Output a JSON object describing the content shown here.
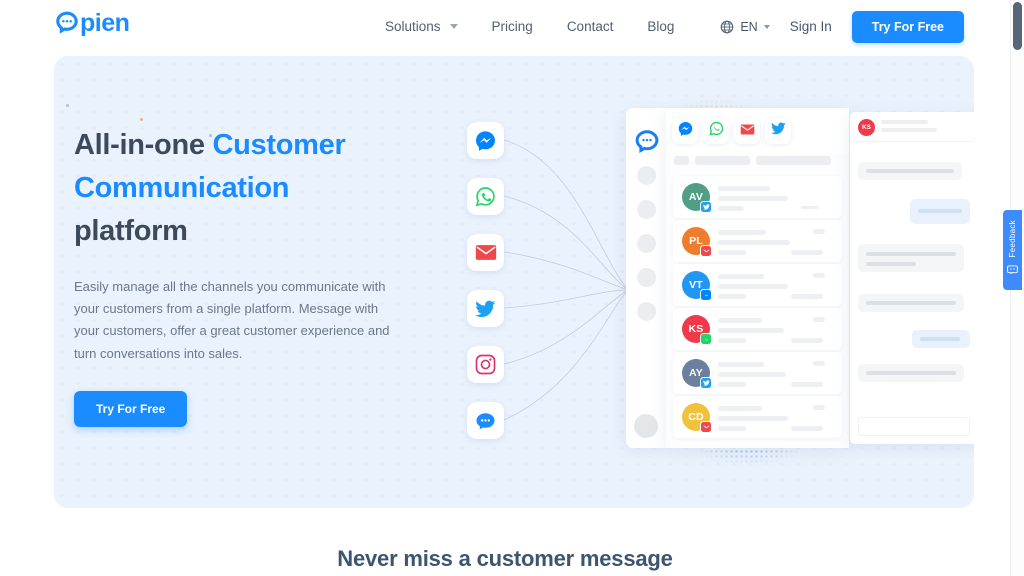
{
  "brand": {
    "name_prefix": "Q",
    "name_rest": "pien",
    "full": "Qpien",
    "color": "#1a8cff"
  },
  "nav": {
    "links": [
      {
        "label": "Solutions",
        "has_caret": true
      },
      {
        "label": "Pricing",
        "has_caret": false
      },
      {
        "label": "Contact",
        "has_caret": false
      },
      {
        "label": "Blog",
        "has_caret": false
      }
    ],
    "language": {
      "code": "EN",
      "icon": "globe-icon"
    },
    "sign_in": "Sign In",
    "cta": "Try For Free"
  },
  "hero": {
    "heading_line1_plain": "All-in-one ",
    "heading_line1_accent": "Customer",
    "heading_line2_accent": "Communication",
    "heading_line3_plain": "platform",
    "paragraph": "Easily manage all the channels you communicate with your customers from a single platform. Message with your customers, offer a great customer experience and turn conversations into sales.",
    "cta": "Try For Free",
    "bg_color": "#eaf2fd",
    "accent_color": "#1a8cff",
    "heading_color": "#3d4a5c"
  },
  "channels": [
    {
      "name": "messenger-icon",
      "label": "Messenger",
      "color": "#0084ff"
    },
    {
      "name": "whatsapp-icon",
      "label": "WhatsApp",
      "color": "#25d366"
    },
    {
      "name": "email-icon",
      "label": "Email",
      "color": "#f0484a"
    },
    {
      "name": "twitter-icon",
      "label": "Twitter",
      "color": "#1da1f2"
    },
    {
      "name": "instagram-icon",
      "label": "Instagram",
      "color": "#e1306c"
    },
    {
      "name": "livechat-icon",
      "label": "Live Chat",
      "color": "#1a8cff"
    }
  ],
  "app_mock": {
    "rail": {
      "logo": "qpien-chat-icon",
      "item_count": 5
    },
    "inbox_tabs": [
      {
        "name": "messenger-icon"
      },
      {
        "name": "whatsapp-icon"
      },
      {
        "name": "email-icon"
      },
      {
        "name": "twitter-icon"
      }
    ],
    "conversations": [
      {
        "initials": "AV",
        "color": "#4f9e85",
        "channel": "twitter-icon",
        "badge_color": "#1da1f2"
      },
      {
        "initials": "PL",
        "color": "#ef7d2e",
        "channel": "email-icon",
        "badge_color": "#f0484a"
      },
      {
        "initials": "VT",
        "color": "#2196f3",
        "channel": "messenger-icon",
        "badge_color": "#0084ff"
      },
      {
        "initials": "KS",
        "color": "#f0394a",
        "channel": "whatsapp-icon",
        "badge_color": "#25d366"
      },
      {
        "initials": "AY",
        "color": "#6b7f9e",
        "channel": "twitter-icon",
        "badge_color": "#1da1f2"
      },
      {
        "initials": "CD",
        "color": "#f0c23c",
        "channel": "email-icon",
        "badge_color": "#f0484a"
      }
    ],
    "thread": {
      "initials": "KS",
      "color": "#f0394a"
    }
  },
  "feedback": {
    "label": "Feedback",
    "icon": "feedback-icon",
    "color": "#3d8bfd"
  },
  "section": {
    "heading": "Never miss a customer message"
  },
  "scrollbar": {
    "thumb_color": "#5a6676"
  }
}
